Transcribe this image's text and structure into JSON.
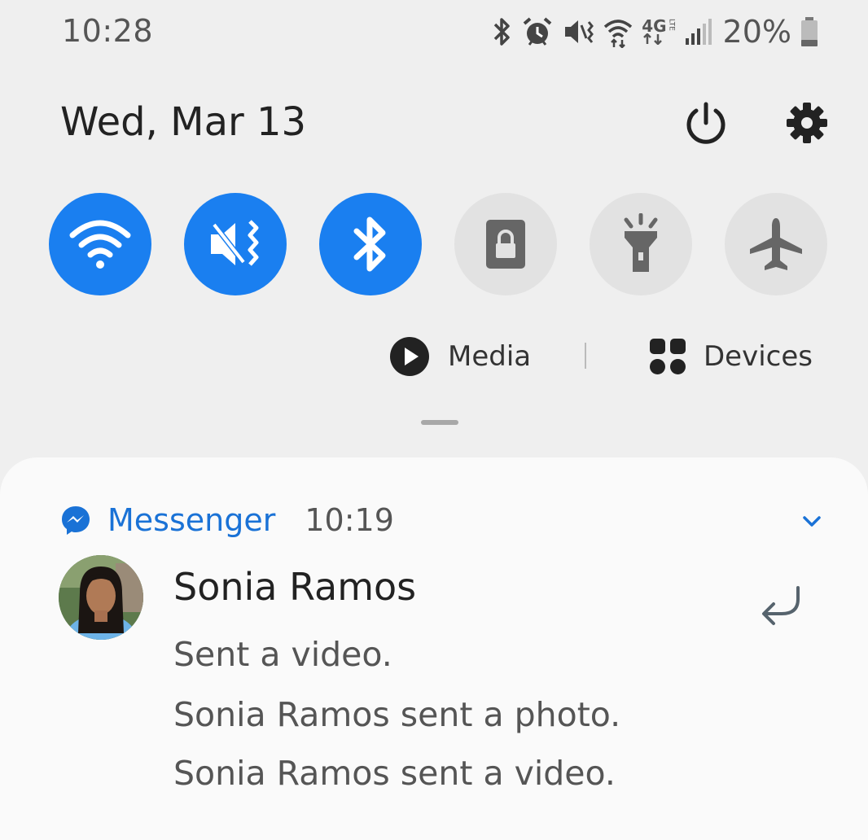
{
  "status_bar": {
    "time": "10:28",
    "network_label": "4G",
    "network_sub": "LTE",
    "battery": "20%",
    "icons": [
      "bluetooth-icon",
      "alarm-icon",
      "vibrate-icon",
      "wifi-icon",
      "lte-icon",
      "signal-icon",
      "battery-icon"
    ]
  },
  "header": {
    "date": "Wed, Mar 13",
    "icons": [
      "power-icon",
      "gear-icon"
    ]
  },
  "quick_toggles": [
    {
      "name": "wifi",
      "state": "on"
    },
    {
      "name": "vibrate",
      "state": "on"
    },
    {
      "name": "bluetooth",
      "state": "on"
    },
    {
      "name": "screen-lock",
      "state": "off"
    },
    {
      "name": "flashlight",
      "state": "off"
    },
    {
      "name": "airplane-mode",
      "state": "off"
    }
  ],
  "media_row": {
    "media_label": "Media",
    "devices_label": "Devices"
  },
  "notification": {
    "app_name": "Messenger",
    "time": "10:19",
    "sender": "Sonia Ramos",
    "messages": [
      "Sent a video.",
      "Sonia Ramos sent a photo.",
      "Sonia Ramos sent a video."
    ]
  },
  "colors": {
    "accent": "#1a7ff0",
    "messenger_blue": "#1a72d6",
    "toggle_off": "#e2e2e2",
    "background": "#efefef"
  }
}
